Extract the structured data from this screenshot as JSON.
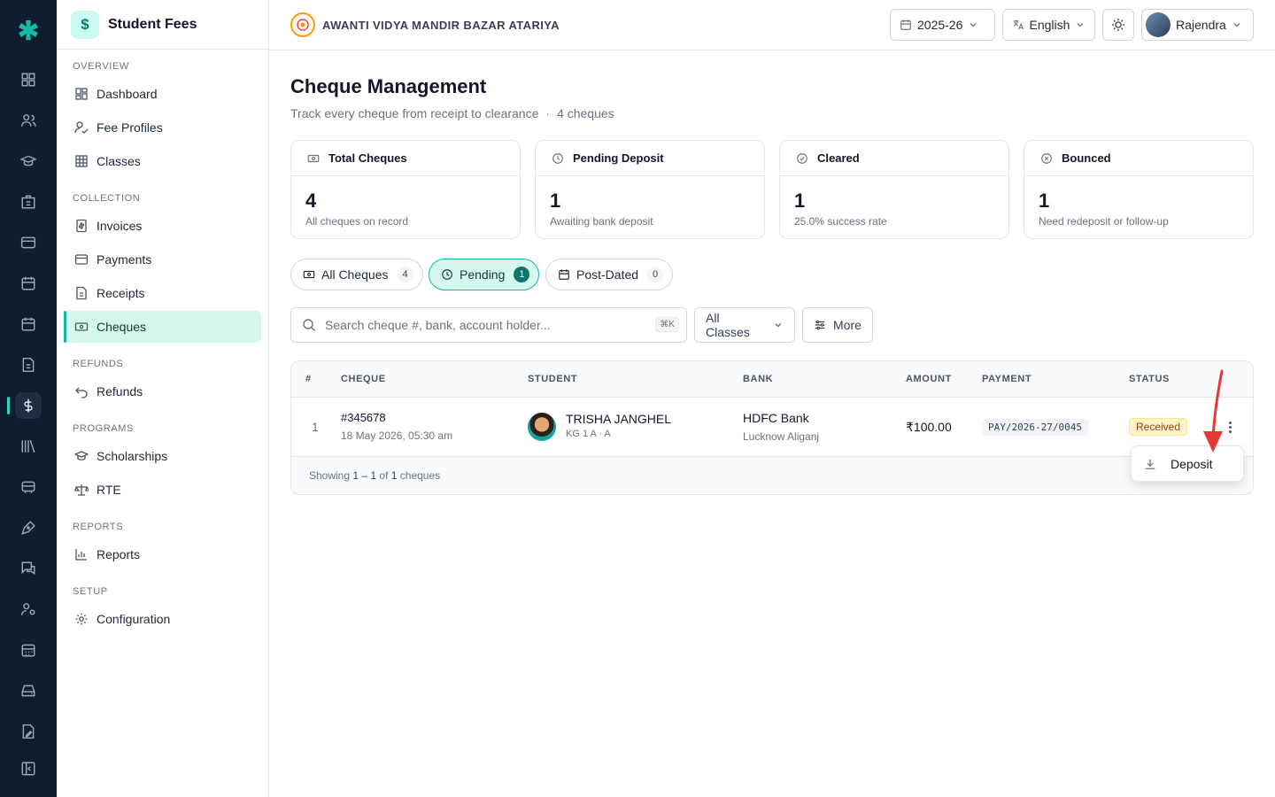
{
  "app": {
    "title": "Student Fees",
    "brand_symbol": "$",
    "accent": "#14b8a6"
  },
  "rail": {
    "icons": [
      "grid-icon",
      "users-icon",
      "graduation-cap-icon",
      "building-icon",
      "credit-card-icon",
      "calendar-icon",
      "calendar-icon",
      "file-icon",
      "dollar-icon",
      "library-icon",
      "bus-icon",
      "pen-icon",
      "messages-icon",
      "user-settings-icon",
      "calendar-grid-icon",
      "drive-icon",
      "document-edit-icon",
      "collapse-panel-icon"
    ],
    "active_index": 8
  },
  "sidebar": {
    "sections": [
      {
        "title": "OVERVIEW",
        "items": [
          {
            "label": "Dashboard",
            "icon": "layout-icon"
          },
          {
            "label": "Fee Profiles",
            "icon": "user-check-icon"
          },
          {
            "label": "Classes",
            "icon": "table-icon"
          }
        ]
      },
      {
        "title": "COLLECTION",
        "items": [
          {
            "label": "Invoices",
            "icon": "invoice-icon"
          },
          {
            "label": "Payments",
            "icon": "card-icon"
          },
          {
            "label": "Receipts",
            "icon": "receipt-icon"
          },
          {
            "label": "Cheques",
            "icon": "cheque-icon"
          }
        ]
      },
      {
        "title": "REFUNDS",
        "items": [
          {
            "label": "Refunds",
            "icon": "undo-icon"
          }
        ]
      },
      {
        "title": "PROGRAMS",
        "items": [
          {
            "label": "Scholarships",
            "icon": "cap-icon"
          },
          {
            "label": "RTE",
            "icon": "scale-icon"
          }
        ]
      },
      {
        "title": "REPORTS",
        "items": [
          {
            "label": "Reports",
            "icon": "bar-chart-icon"
          }
        ]
      },
      {
        "title": "SETUP",
        "items": [
          {
            "label": "Configuration",
            "icon": "gear-icon"
          }
        ]
      }
    ],
    "active": "Cheques"
  },
  "topbar": {
    "school": "AWANTI VIDYA MANDIR BAZAR ATARIYA",
    "year": "2025-26",
    "language": "English",
    "user": "Rajendra"
  },
  "page": {
    "title": "Cheque Management",
    "subtitle": "Track every cheque from receipt to clearance",
    "separator": "·",
    "count_text": "4 cheques"
  },
  "stats": [
    {
      "label": "Total Cheques",
      "value": "4",
      "note": "All cheques on record",
      "icon": "cheque-icon"
    },
    {
      "label": "Pending Deposit",
      "value": "1",
      "note": "Awaiting bank deposit",
      "icon": "clock-icon"
    },
    {
      "label": "Cleared",
      "value": "1",
      "note": "25.0% success rate",
      "icon": "check-circle-icon"
    },
    {
      "label": "Bounced",
      "value": "1",
      "note": "Need redeposit or follow-up",
      "icon": "x-circle-icon"
    }
  ],
  "tabs": [
    {
      "label": "All Cheques",
      "count": "4"
    },
    {
      "label": "Pending",
      "count": "1"
    },
    {
      "label": "Post-Dated",
      "count": "0"
    }
  ],
  "active_tab": "Pending",
  "search": {
    "placeholder": "Search cheque #, bank, account holder...",
    "value": "",
    "shortcut": "⌘K"
  },
  "filters": {
    "classes": "All Classes",
    "more": "More"
  },
  "table": {
    "columns": [
      "#",
      "CHEQUE",
      "STUDENT",
      "BANK",
      "AMOUNT",
      "PAYMENT",
      "STATUS"
    ],
    "rows": [
      {
        "index": "1",
        "cheque_no": "#345678",
        "cheque_date": "18 May 2026, 05:30 am",
        "student": "TRISHA JANGHEL",
        "student_class": "KG 1 A · A",
        "bank": "HDFC Bank",
        "branch": "Lucknow Aliganj",
        "amount": "₹100.00",
        "payment": "PAY/2026-27/0045",
        "status": "Received"
      }
    ],
    "footer": {
      "prefix": "Showing ",
      "range": "1 – 1",
      "mid": " of ",
      "total": "1",
      "suffix": " cheques"
    }
  },
  "row_menu": {
    "items": [
      {
        "label": "Deposit",
        "icon": "download-icon"
      }
    ]
  },
  "annotation": {
    "color": "#e53935"
  }
}
